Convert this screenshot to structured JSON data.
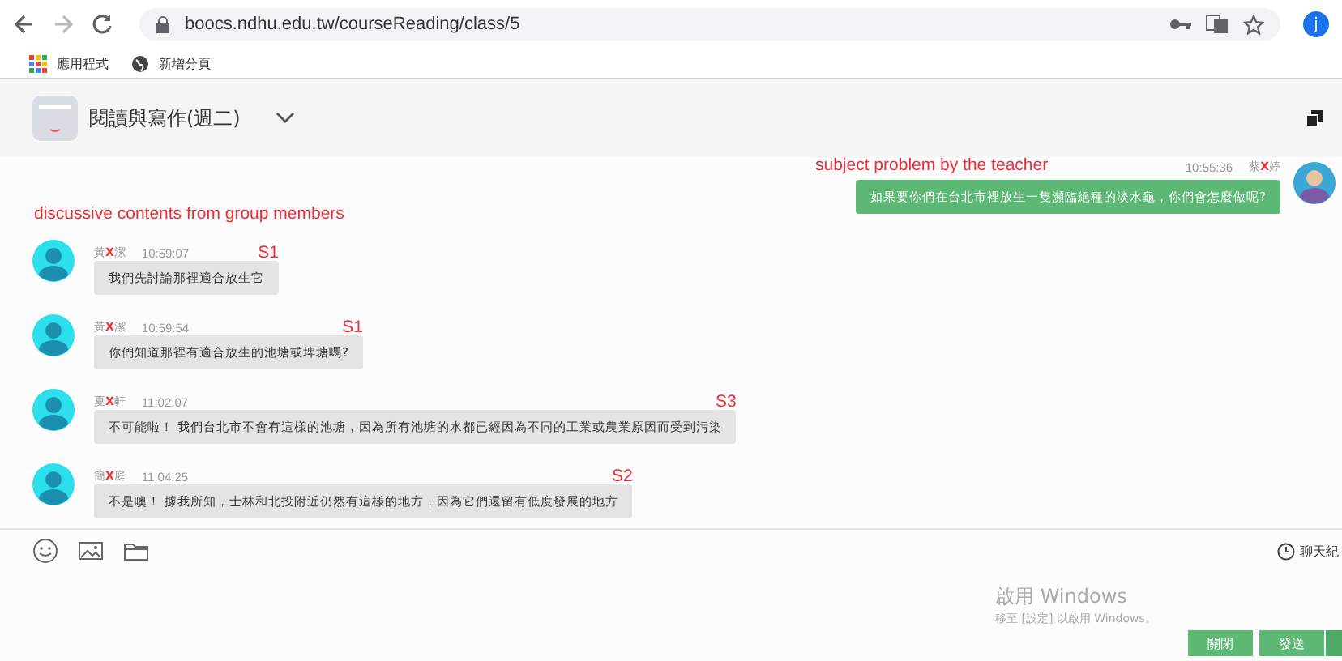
{
  "browser": {
    "url": "boocs.ndhu.edu.tw/courseReading/class/5",
    "profile_initial": "j",
    "bookmarks": [
      {
        "kind": "apps",
        "label": "應用程式"
      },
      {
        "kind": "globe",
        "label": "新增分頁"
      }
    ]
  },
  "course": {
    "title": "閱讀與寫作(週二)"
  },
  "teacher_message": {
    "annotation": "subject problem by the teacher",
    "time": "10:55:36",
    "name_start": "蔡",
    "name_mask": "X",
    "name_end": "婷",
    "text": "如果要你們在台北市裡放生一隻瀕臨絕種的淡水龜，你們會怎麼做呢?"
  },
  "group_annotation": "discussive contents from group members",
  "messages": [
    {
      "name_start": "黃",
      "name_mask": "X",
      "name_end": "潔",
      "time": "10:59:07",
      "tag": "S1",
      "text": "我們先討論那裡適合放生它"
    },
    {
      "name_start": "黃",
      "name_mask": "X",
      "name_end": "潔",
      "time": "10:59:54",
      "tag": "S1",
      "text": "你們知道那裡有適合放生的池塘或埤塘嗎?"
    },
    {
      "name_start": "夏",
      "name_mask": "X",
      "name_end": "軒",
      "time": "11:02:07",
      "tag": "S3",
      "text": "不可能啦！ 我們台北市不會有這樣的池塘，因為所有池塘的水都已經因為不同的工業或農業原因而受到污染"
    },
    {
      "name_start": "簡",
      "name_mask": "X",
      "name_end": "庭",
      "time": "11:04:25",
      "tag": "S2",
      "text": "不是噢！ 據我所知，士林和北投附近仍然有這樣的地方，因為它們還留有低度發展的地方"
    }
  ],
  "composer": {
    "tools": [
      {
        "kind": "emoji"
      },
      {
        "kind": "image"
      },
      {
        "kind": "folder"
      }
    ],
    "history_label": "聊天紀"
  },
  "os_notice": {
    "title": "啟用 Windows",
    "detail": "移至 [設定] 以啟用 Windows。"
  },
  "buttons": [
    {
      "label": "關閉"
    },
    {
      "label": "發送"
    }
  ]
}
